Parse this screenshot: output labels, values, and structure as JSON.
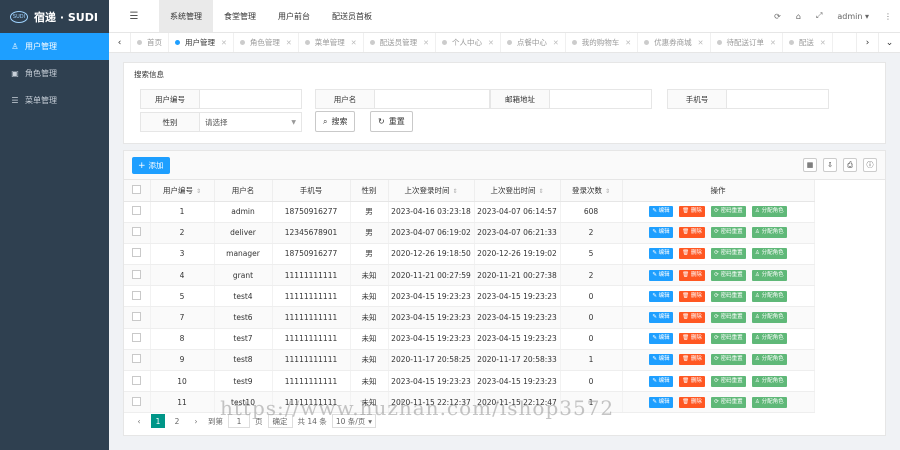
{
  "app": {
    "logo_text": "宿递 · SUDI",
    "logo_badge": "SUDI"
  },
  "sidebar": {
    "items": [
      {
        "label": "用户管理",
        "icon": "user-icon",
        "glyph": "♙",
        "active": true
      },
      {
        "label": "角色管理",
        "icon": "id-card-icon",
        "glyph": "▣",
        "active": false
      },
      {
        "label": "菜单管理",
        "icon": "menu-list-icon",
        "glyph": "☰",
        "active": false
      }
    ]
  },
  "topbar": {
    "nav": [
      {
        "label": "系统管理",
        "active": true
      },
      {
        "label": "食堂管理"
      },
      {
        "label": "用户前台"
      },
      {
        "label": "配送员首板"
      }
    ],
    "user": "admin"
  },
  "tabs": [
    {
      "label": "首页",
      "active": false
    },
    {
      "label": "用户管理",
      "active": true
    },
    {
      "label": "角色管理"
    },
    {
      "label": "菜单管理"
    },
    {
      "label": "配送员管理"
    },
    {
      "label": "个人中心"
    },
    {
      "label": "点餐中心"
    },
    {
      "label": "我的购物车"
    },
    {
      "label": "优惠券商城"
    },
    {
      "label": "待配送订单"
    },
    {
      "label": "配送"
    }
  ],
  "search": {
    "title": "搜索信息",
    "fields": [
      {
        "label": "用户编号",
        "value": ""
      },
      {
        "label": "用户名",
        "value": ""
      },
      {
        "label": "邮箱地址",
        "value": ""
      },
      {
        "label": "手机号",
        "value": ""
      },
      {
        "label": "性别",
        "value": "请选择"
      }
    ],
    "search_btn": "搜索",
    "reset_btn": "重置"
  },
  "table": {
    "add_btn": "添加",
    "columns": [
      "用户编号",
      "用户名",
      "手机号",
      "性别",
      "上次登录时间",
      "上次登出时间",
      "登录次数",
      "操作"
    ],
    "actions": {
      "edit": "编辑",
      "delete": "删除",
      "reset": "密码重置",
      "assign": "分配角色"
    },
    "rows": [
      [
        "1",
        "admin",
        "18750916277",
        "男",
        "2023-04-16 03:23:18",
        "2023-04-07 06:14:57",
        "608"
      ],
      [
        "2",
        "deliver",
        "12345678901",
        "男",
        "2023-04-07 06:19:02",
        "2023-04-07 06:21:33",
        "2"
      ],
      [
        "3",
        "manager",
        "18750916277",
        "男",
        "2020-12-26 19:18:50",
        "2020-12-26 19:19:02",
        "5"
      ],
      [
        "4",
        "grant",
        "11111111111",
        "未知",
        "2020-11-21 00:27:59",
        "2020-11-21 00:27:38",
        "2"
      ],
      [
        "5",
        "test4",
        "11111111111",
        "未知",
        "2023-04-15 19:23:23",
        "2023-04-15 19:23:23",
        "0"
      ],
      [
        "7",
        "test6",
        "11111111111",
        "未知",
        "2023-04-15 19:23:23",
        "2023-04-15 19:23:23",
        "0"
      ],
      [
        "8",
        "test7",
        "11111111111",
        "未知",
        "2023-04-15 19:23:23",
        "2023-04-15 19:23:23",
        "0"
      ],
      [
        "9",
        "test8",
        "11111111111",
        "未知",
        "2020-11-17 20:58:25",
        "2020-11-17 20:58:33",
        "1"
      ],
      [
        "10",
        "test9",
        "11111111111",
        "未知",
        "2023-04-15 19:23:23",
        "2023-04-15 19:23:23",
        "0"
      ],
      [
        "11",
        "test10",
        "11111111111",
        "未知",
        "2020-11-15 22:12:37",
        "2020-11-15 22:12:47",
        "1"
      ]
    ]
  },
  "pager": {
    "pages": [
      "1",
      "2"
    ],
    "goto_label": "到第",
    "page_input": "1",
    "page_suffix": "页",
    "confirm": "确定",
    "total": "共 14 条",
    "per_page": "10 条/页"
  },
  "watermark": "https://www.huzhan.com/ishop3572"
}
